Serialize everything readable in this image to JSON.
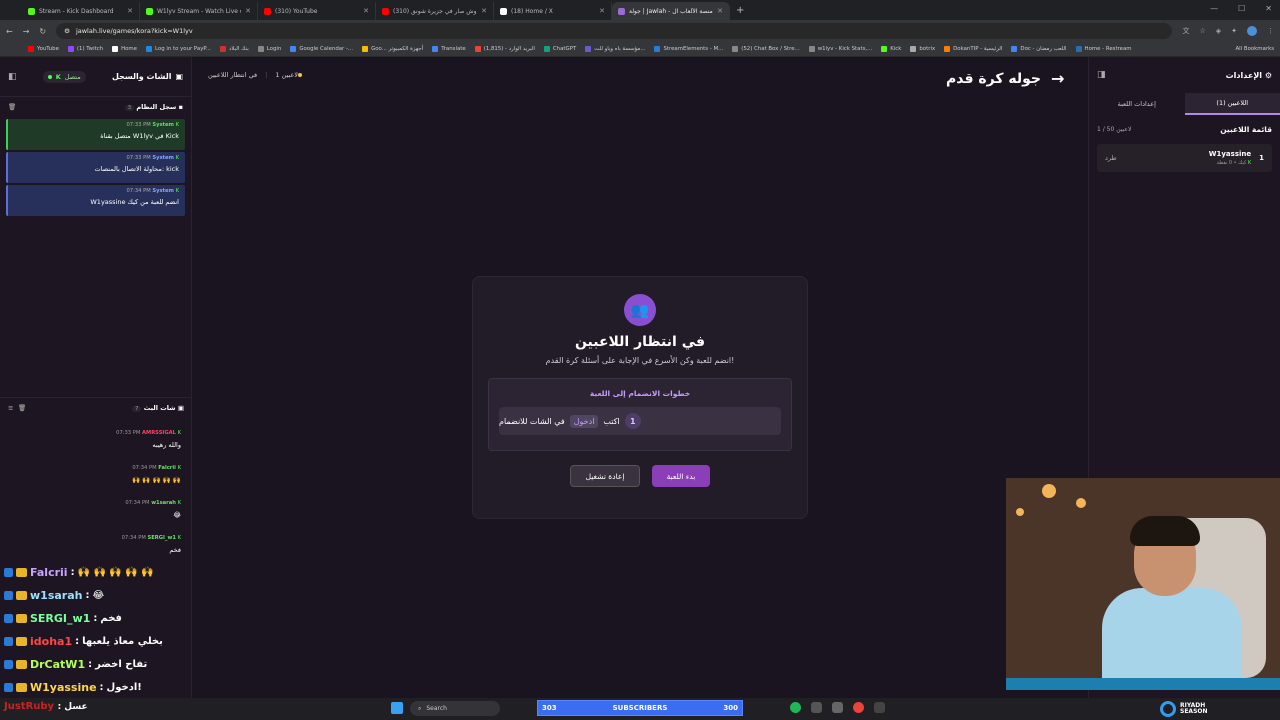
{
  "browser": {
    "tabs": [
      {
        "title": "Stream - Kick Dashboard",
        "color": "#53fc18"
      },
      {
        "title": "W1lyv Stream - Watch Live on",
        "color": "#53fc18"
      },
      {
        "title": "(310) YouTube",
        "color": "#ff0000"
      },
      {
        "title": "(310) وش صار في جزيرة شونق",
        "color": "#ff0000"
      },
      {
        "title": "(18) Home / X",
        "color": "#ffffff"
      },
      {
        "title": "جولة | Jawlah - منصة الألعاب ال...",
        "color": "#9b6bd6",
        "active": true
      }
    ],
    "new_tab": "+",
    "url": "jawlah.live/games/kora?kick=W1lyv",
    "bookmarks": [
      "YouTube",
      "(1) Twitch",
      "Home",
      "Log in to your PayP...",
      "بنك البلاد",
      "Login",
      "Google Calendar -...",
      "Goo... أجهزة الكمبيوتر",
      "Translate",
      "البريد الوارد - (1,815)",
      "ChatGPT",
      "مؤسسة باه وياو للت...",
      "StreamElements - M...",
      "(52) Chat Box / Stre...",
      "w1lyv - Kick Stats,...",
      "Kick",
      "botrix",
      "DokanTIP - الرئيسية",
      "Doc - اللعب رمضان",
      "Home - Restream"
    ],
    "all_bookmarks": "All Bookmarks"
  },
  "left": {
    "title": "الشات والسجل",
    "status": "متصل",
    "system_log": {
      "title": "سجل النظام",
      "count": "3",
      "items": [
        {
          "sender": "System",
          "time": "07:33 PM",
          "text": "متصل بقناة W1lyv في Kick",
          "kind": "green"
        },
        {
          "sender": "System",
          "time": "07:33 PM",
          "text": "محاولة الاتصال بالمنصات: kick",
          "kind": "blue"
        },
        {
          "sender": "System",
          "time": "07:34 PM",
          "text": "W1yassine انضم للعبة من كيك",
          "kind": "blue"
        }
      ]
    },
    "chat": {
      "title": "شات البث",
      "count": "7",
      "messages": [
        {
          "user": "AMRSSIGAL",
          "time": "07:33 PM",
          "text": "والله رهيبه"
        },
        {
          "user": "Falcrii",
          "time": "07:34 PM",
          "text": "🙌 🙌 🙌 🙌 🙌"
        },
        {
          "user": "w1sarah",
          "time": "07:34 PM",
          "text": "😂"
        },
        {
          "user": "SERGI_w1",
          "time": "07:34 PM",
          "text": "فخم"
        }
      ]
    }
  },
  "overlay_chat": [
    {
      "user": "Falcrii",
      "color": "#c7a4ff",
      "text": "🙌 🙌 🙌 🙌 🙌"
    },
    {
      "user": "w1sarah",
      "color": "#9be0ff",
      "text": "😂"
    },
    {
      "user": "SERGI_w1",
      "color": "#7bff9a",
      "text": "فخم"
    },
    {
      "user": "idoha1",
      "color": "#ff4545",
      "text": "بخلي معاذ يلعبها"
    },
    {
      "user": "DrCatW1",
      "color": "#b6ff5a",
      "text": "تفاح اخضر"
    },
    {
      "user": "W1yassine",
      "color": "#ffd84d",
      "text": "ادخول!"
    }
  ],
  "overlay_bottom_user": "JustRuby",
  "overlay_bottom_text": "عسل",
  "top": {
    "players_count": "1 لاعبين",
    "waiting": "في انتظار اللاعبين",
    "game_title": "جوله كرة قدم"
  },
  "modal": {
    "title": "في انتظار اللاعبين",
    "subtitle": "انضم للعبة وكن الأسرع في الإجابة على أسئلة كرة القدم!",
    "steps_title": "خطوات الانضمام إلى اللعبة",
    "step_num": "1",
    "step_prefix": "اكتب",
    "step_keyword": "ادخول",
    "step_suffix": "في الشات للانضمام",
    "start_button": "بدء اللعبة",
    "restart_button": "إعادة تشغيل"
  },
  "right": {
    "title": "الإعدادات",
    "tab_players": "اللاعبين (1)",
    "tab_settings": "إعدادات اللعبة",
    "list_title": "قائمة اللاعبين",
    "list_count": "1 / 50 لاعبين",
    "player": {
      "rank": "1",
      "name": "W1yassine",
      "sub": "كيك • 0 نقطة",
      "kick": "طرد"
    }
  },
  "taskbar": {
    "search": "Search",
    "subs_label": "SUBSCRIBERS",
    "subs_current": "303",
    "subs_goal": "300",
    "brand_line1": "RIYADH",
    "brand_line2": "SEASON"
  }
}
